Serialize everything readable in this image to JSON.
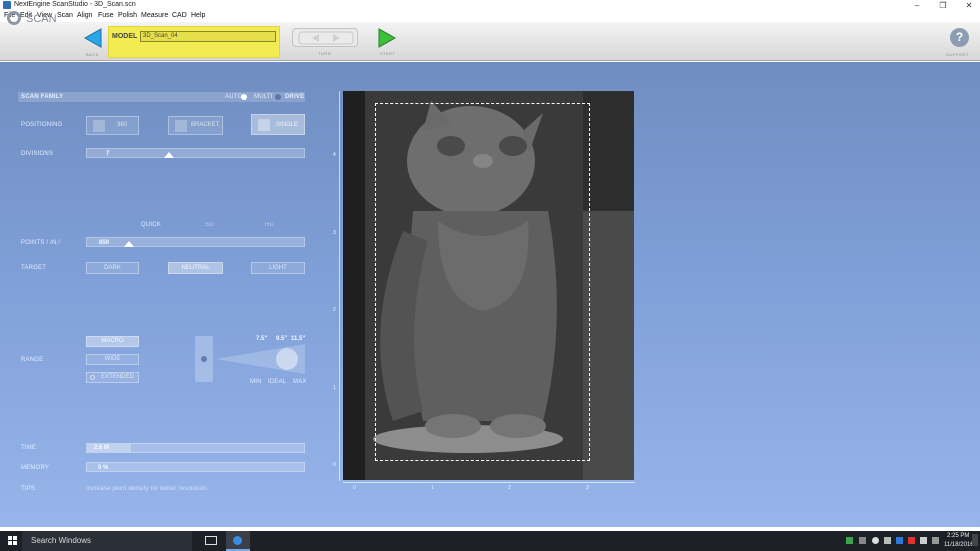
{
  "window": {
    "title": "NextEngine ScanStudio - 3D_Scan.scn"
  },
  "menu": [
    "File",
    "Edit",
    "View",
    "Scan",
    "Align",
    "Fuse",
    "Polish",
    "Measure",
    "CAD",
    "Help"
  ],
  "toolbar": {
    "brand": "SCAN",
    "back_caption": "BACK",
    "model_label": "MODEL",
    "model_value": "3D_Scan_04",
    "turn_caption": "TURN",
    "start_caption": "START",
    "help_caption": "SUPPORT"
  },
  "panel": {
    "scan_family": "SCAN FAMILY",
    "auto": "AUTO",
    "multi": "MULTI",
    "drive": "DRIVE",
    "positioning": "POSITIONING",
    "pos_360": "360",
    "pos_bracket": "BRACKET",
    "pos_single": "SINGLE",
    "divisions": "DIVISIONS",
    "divisions_value": "7",
    "quick": "QUICK",
    "sd": "SD",
    "hd": "HD",
    "points": "POINTS / IN.²",
    "points_value": "850",
    "target": "TARGET",
    "dark": "DARK",
    "neutral": "NEUTRAL",
    "light": "LIGHT",
    "range": "RANGE",
    "macro": "MACRO",
    "wide": "WIDE",
    "extended": "EXTENDED",
    "dist_75": "7.5\"",
    "dist_95": "9.5\"",
    "dist_115": "11.5\"",
    "min": "MIN",
    "ideal": "IDEAL",
    "max": "MAX",
    "time": "TIME",
    "time_value": "2.6 M",
    "memory": "MEMORY",
    "memory_value": "0 %",
    "tips": "TIPS",
    "tips_text": "Increase point density for better resolution."
  },
  "ruler": {
    "y": [
      "4",
      "3",
      "2",
      "1",
      "0"
    ],
    "x": [
      "0",
      "1",
      "2",
      "3"
    ]
  },
  "taskbar": {
    "search": "Search Windows",
    "time": "2:25 PM",
    "date": "11/18/2016"
  },
  "colors": {
    "accent_yellow": "#f2ec52",
    "bg_blue": "#7e9fd7",
    "taskbar": "#1d2027"
  }
}
